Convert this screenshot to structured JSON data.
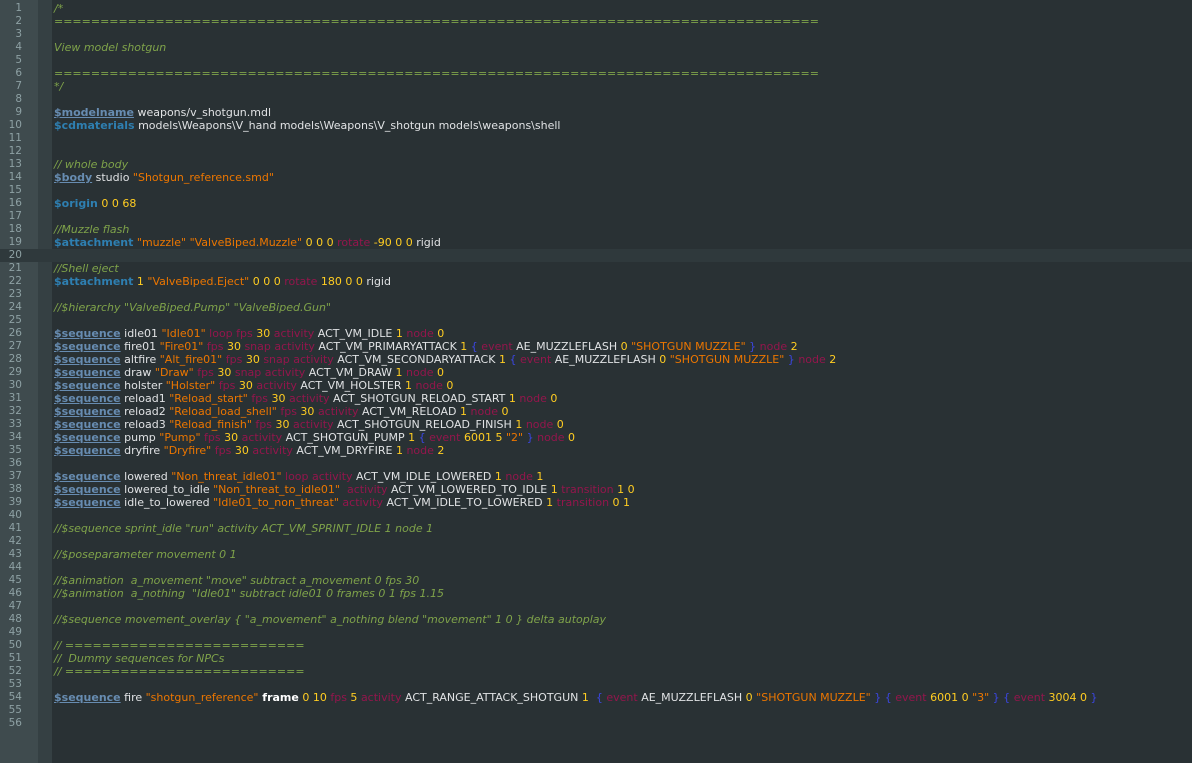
{
  "colors": {
    "background": "#293134",
    "gutter": "#3f4b4e",
    "comment": "#7fa34a",
    "keyword": "#678cb1",
    "string": "#ec7600",
    "number": "#ffcd22",
    "option": "#93164c",
    "brace": "#3b46e0"
  },
  "lines": [
    [
      {
        "t": "/*",
        "c": "cmt"
      }
    ],
    [
      {
        "t": "===================================================================================",
        "c": "cmt"
      }
    ],
    [],
    [
      {
        "t": "View model shotgun",
        "c": "cmt"
      }
    ],
    [],
    [
      {
        "t": "===================================================================================",
        "c": "cmt"
      }
    ],
    [
      {
        "t": "*/",
        "c": "cmt"
      }
    ],
    [],
    [
      {
        "t": "$modelname",
        "c": "kw"
      },
      {
        "t": " weapons/v_shotgun.mdl",
        "c": "plain"
      }
    ],
    [
      {
        "t": "$cdmaterials",
        "c": "kw2"
      },
      {
        "t": " models\\Weapons\\V_hand models\\Weapons\\V_shotgun models\\weapons\\shell",
        "c": "plain"
      }
    ],
    [],
    [],
    [
      {
        "t": "// whole body",
        "c": "cmt"
      }
    ],
    [
      {
        "t": "$body",
        "c": "kw"
      },
      {
        "t": " studio ",
        "c": "plain"
      },
      {
        "t": "\"Shotgun_reference.smd\"",
        "c": "str"
      }
    ],
    [],
    [
      {
        "t": "$origin",
        "c": "kw2"
      },
      {
        "t": " 0 0 68",
        "c": "num"
      }
    ],
    [],
    [
      {
        "t": "//Muzzle flash",
        "c": "cmt"
      }
    ],
    [
      {
        "t": "$attachment",
        "c": "kw2"
      },
      {
        "t": " ",
        "c": "plain"
      },
      {
        "t": "\"muzzle\" \"ValveBiped.Muzzle\"",
        "c": "str"
      },
      {
        "t": " 0 0 0 ",
        "c": "num"
      },
      {
        "t": "rotate",
        "c": "opt"
      },
      {
        "t": " -90 0 0 ",
        "c": "num"
      },
      {
        "t": "rigid",
        "c": "plain"
      }
    ],
    [],
    [
      {
        "t": "//Shell eject",
        "c": "cmt"
      }
    ],
    [
      {
        "t": "$attachment",
        "c": "kw2"
      },
      {
        "t": " 1 ",
        "c": "num"
      },
      {
        "t": "\"ValveBiped.Eject\"",
        "c": "str"
      },
      {
        "t": " 0 0 0 ",
        "c": "num"
      },
      {
        "t": "rotate",
        "c": "opt"
      },
      {
        "t": " 180 0 0 ",
        "c": "num"
      },
      {
        "t": "rigid",
        "c": "plain"
      }
    ],
    [],
    [
      {
        "t": "//$hierarchy \"ValveBiped.Pump\" \"ValveBiped.Gun\"",
        "c": "cmt"
      }
    ],
    [],
    [
      {
        "t": "$sequence",
        "c": "kw"
      },
      {
        "t": " idle01 ",
        "c": "plain"
      },
      {
        "t": "\"Idle01\"",
        "c": "str"
      },
      {
        "t": " loop fps",
        "c": "opt"
      },
      {
        "t": " 30 ",
        "c": "num"
      },
      {
        "t": "activity",
        "c": "opt"
      },
      {
        "t": " ACT_VM_IDLE ",
        "c": "plain"
      },
      {
        "t": "1 ",
        "c": "num"
      },
      {
        "t": "node",
        "c": "opt"
      },
      {
        "t": " 0",
        "c": "num"
      }
    ],
    [
      {
        "t": "$sequence",
        "c": "kw"
      },
      {
        "t": " fire01 ",
        "c": "plain"
      },
      {
        "t": "\"Fire01\"",
        "c": "str"
      },
      {
        "t": " fps",
        "c": "opt"
      },
      {
        "t": " 30 ",
        "c": "num"
      },
      {
        "t": "snap activity",
        "c": "opt"
      },
      {
        "t": " ACT_VM_PRIMARYATTACK ",
        "c": "plain"
      },
      {
        "t": "1 ",
        "c": "num"
      },
      {
        "t": "{ ",
        "c": "brace"
      },
      {
        "t": "event",
        "c": "opt"
      },
      {
        "t": " AE_MUZZLEFLASH ",
        "c": "plain"
      },
      {
        "t": "0 ",
        "c": "num"
      },
      {
        "t": "\"SHOTGUN MUZZLE\"",
        "c": "str"
      },
      {
        "t": " } ",
        "c": "brace"
      },
      {
        "t": "node",
        "c": "opt"
      },
      {
        "t": " 2",
        "c": "num"
      }
    ],
    [
      {
        "t": "$sequence",
        "c": "kw"
      },
      {
        "t": " altfire ",
        "c": "plain"
      },
      {
        "t": "\"Alt_fire01\"",
        "c": "str"
      },
      {
        "t": " fps",
        "c": "opt"
      },
      {
        "t": " 30 ",
        "c": "num"
      },
      {
        "t": "snap activity",
        "c": "opt"
      },
      {
        "t": " ACT_VM_SECONDARYATTACK ",
        "c": "plain"
      },
      {
        "t": "1 ",
        "c": "num"
      },
      {
        "t": "{ ",
        "c": "brace"
      },
      {
        "t": "event",
        "c": "opt"
      },
      {
        "t": " AE_MUZZLEFLASH ",
        "c": "plain"
      },
      {
        "t": "0 ",
        "c": "num"
      },
      {
        "t": "\"SHOTGUN MUZZLE\"",
        "c": "str"
      },
      {
        "t": " } ",
        "c": "brace"
      },
      {
        "t": "node",
        "c": "opt"
      },
      {
        "t": " 2",
        "c": "num"
      }
    ],
    [
      {
        "t": "$sequence",
        "c": "kw"
      },
      {
        "t": " draw ",
        "c": "plain"
      },
      {
        "t": "\"Draw\"",
        "c": "str"
      },
      {
        "t": " fps",
        "c": "opt"
      },
      {
        "t": " 30 ",
        "c": "num"
      },
      {
        "t": "snap activity",
        "c": "opt"
      },
      {
        "t": " ACT_VM_DRAW ",
        "c": "plain"
      },
      {
        "t": "1 ",
        "c": "num"
      },
      {
        "t": "node",
        "c": "opt"
      },
      {
        "t": " 0",
        "c": "num"
      }
    ],
    [
      {
        "t": "$sequence",
        "c": "kw"
      },
      {
        "t": " holster ",
        "c": "plain"
      },
      {
        "t": "\"Holster\"",
        "c": "str"
      },
      {
        "t": " fps",
        "c": "opt"
      },
      {
        "t": " 30 ",
        "c": "num"
      },
      {
        "t": "activity",
        "c": "opt"
      },
      {
        "t": " ACT_VM_HOLSTER ",
        "c": "plain"
      },
      {
        "t": "1 ",
        "c": "num"
      },
      {
        "t": "node",
        "c": "opt"
      },
      {
        "t": " 0",
        "c": "num"
      }
    ],
    [
      {
        "t": "$sequence",
        "c": "kw"
      },
      {
        "t": " reload1 ",
        "c": "plain"
      },
      {
        "t": "\"Reload_start\"",
        "c": "str"
      },
      {
        "t": " fps",
        "c": "opt"
      },
      {
        "t": " 30 ",
        "c": "num"
      },
      {
        "t": "activity",
        "c": "opt"
      },
      {
        "t": " ACT_SHOTGUN_RELOAD_START ",
        "c": "plain"
      },
      {
        "t": "1 ",
        "c": "num"
      },
      {
        "t": "node",
        "c": "opt"
      },
      {
        "t": " 0",
        "c": "num"
      }
    ],
    [
      {
        "t": "$sequence",
        "c": "kw"
      },
      {
        "t": " reload2 ",
        "c": "plain"
      },
      {
        "t": "\"Reload_load_shell\"",
        "c": "str"
      },
      {
        "t": " fps",
        "c": "opt"
      },
      {
        "t": " 30 ",
        "c": "num"
      },
      {
        "t": "activity",
        "c": "opt"
      },
      {
        "t": " ACT_VM_RELOAD ",
        "c": "plain"
      },
      {
        "t": "1 ",
        "c": "num"
      },
      {
        "t": "node",
        "c": "opt"
      },
      {
        "t": " 0",
        "c": "num"
      }
    ],
    [
      {
        "t": "$sequence",
        "c": "kw"
      },
      {
        "t": " reload3 ",
        "c": "plain"
      },
      {
        "t": "\"Reload_finish\"",
        "c": "str"
      },
      {
        "t": " fps",
        "c": "opt"
      },
      {
        "t": " 30 ",
        "c": "num"
      },
      {
        "t": "activity",
        "c": "opt"
      },
      {
        "t": " ACT_SHOTGUN_RELOAD_FINISH ",
        "c": "plain"
      },
      {
        "t": "1 ",
        "c": "num"
      },
      {
        "t": "node",
        "c": "opt"
      },
      {
        "t": " 0",
        "c": "num"
      }
    ],
    [
      {
        "t": "$sequence",
        "c": "kw"
      },
      {
        "t": " pump ",
        "c": "plain"
      },
      {
        "t": "\"Pump\"",
        "c": "str"
      },
      {
        "t": " fps",
        "c": "opt"
      },
      {
        "t": " 30 ",
        "c": "num"
      },
      {
        "t": "activity",
        "c": "opt"
      },
      {
        "t": " ACT_SHOTGUN_PUMP ",
        "c": "plain"
      },
      {
        "t": "1 ",
        "c": "num"
      },
      {
        "t": "{ ",
        "c": "brace"
      },
      {
        "t": "event",
        "c": "opt"
      },
      {
        "t": " 6001 5 ",
        "c": "num"
      },
      {
        "t": "\"2\"",
        "c": "str"
      },
      {
        "t": " } ",
        "c": "brace"
      },
      {
        "t": "node",
        "c": "opt"
      },
      {
        "t": " 0",
        "c": "num"
      }
    ],
    [
      {
        "t": "$sequence",
        "c": "kw"
      },
      {
        "t": " dryfire ",
        "c": "plain"
      },
      {
        "t": "\"Dryfire\"",
        "c": "str"
      },
      {
        "t": " fps",
        "c": "opt"
      },
      {
        "t": " 30 ",
        "c": "num"
      },
      {
        "t": "activity",
        "c": "opt"
      },
      {
        "t": " ACT_VM_DRYFIRE ",
        "c": "plain"
      },
      {
        "t": "1 ",
        "c": "num"
      },
      {
        "t": "node",
        "c": "opt"
      },
      {
        "t": " 2",
        "c": "num"
      }
    ],
    [],
    [
      {
        "t": "$sequence",
        "c": "kw"
      },
      {
        "t": " lowered ",
        "c": "plain"
      },
      {
        "t": "\"Non_threat_idle01\"",
        "c": "str"
      },
      {
        "t": " loop activity",
        "c": "opt"
      },
      {
        "t": " ACT_VM_IDLE_LOWERED ",
        "c": "plain"
      },
      {
        "t": "1 ",
        "c": "num"
      },
      {
        "t": "node",
        "c": "opt"
      },
      {
        "t": " 1",
        "c": "num"
      }
    ],
    [
      {
        "t": "$sequence",
        "c": "kw"
      },
      {
        "t": " lowered_to_idle ",
        "c": "plain"
      },
      {
        "t": "\"Non_threat_to_idle01\"",
        "c": "str"
      },
      {
        "t": "  activity",
        "c": "opt"
      },
      {
        "t": " ACT_VM_LOWERED_TO_IDLE ",
        "c": "plain"
      },
      {
        "t": "1 ",
        "c": "num"
      },
      {
        "t": "transition",
        "c": "opt"
      },
      {
        "t": " 1 0",
        "c": "num"
      }
    ],
    [
      {
        "t": "$sequence",
        "c": "kw"
      },
      {
        "t": " idle_to_lowered ",
        "c": "plain"
      },
      {
        "t": "\"Idle01_to_non_threat\"",
        "c": "str"
      },
      {
        "t": " activity",
        "c": "opt"
      },
      {
        "t": " ACT_VM_IDLE_TO_LOWERED ",
        "c": "plain"
      },
      {
        "t": "1 ",
        "c": "num"
      },
      {
        "t": "transition",
        "c": "opt"
      },
      {
        "t": " 0 1",
        "c": "num"
      }
    ],
    [],
    [
      {
        "t": "//$sequence sprint_idle \"run\" activity ACT_VM_SPRINT_IDLE 1 node 1",
        "c": "cmt"
      }
    ],
    [],
    [
      {
        "t": "//$poseparameter movement 0 1",
        "c": "cmt"
      }
    ],
    [],
    [
      {
        "t": "//$animation  a_movement \"move\" subtract a_movement 0 fps 30",
        "c": "cmt"
      }
    ],
    [
      {
        "t": "//$animation  a_nothing  \"Idle01\" subtract idle01 0 frames 0 1 fps 1.15",
        "c": "cmt"
      }
    ],
    [],
    [
      {
        "t": "//$sequence movement_overlay { \"a_movement\" a_nothing blend \"movement\" 1 0 } delta autoplay",
        "c": "cmt"
      }
    ],
    [],
    [
      {
        "t": "// ==========================",
        "c": "cmt"
      }
    ],
    [
      {
        "t": "//  Dummy sequences for NPCs",
        "c": "cmt"
      }
    ],
    [
      {
        "t": "// ==========================",
        "c": "cmt"
      }
    ],
    [],
    [
      {
        "t": "$sequence",
        "c": "kw"
      },
      {
        "t": " fire ",
        "c": "plain"
      },
      {
        "t": "\"shotgun_reference\"",
        "c": "str"
      },
      {
        "t": " frame",
        "c": "bold"
      },
      {
        "t": " 0 10 ",
        "c": "num"
      },
      {
        "t": "fps",
        "c": "opt"
      },
      {
        "t": " 5 ",
        "c": "num"
      },
      {
        "t": "activity",
        "c": "opt"
      },
      {
        "t": " ACT_RANGE_ATTACK_SHOTGUN ",
        "c": "plain"
      },
      {
        "t": "1  ",
        "c": "num"
      },
      {
        "t": "{ ",
        "c": "brace"
      },
      {
        "t": "event",
        "c": "opt"
      },
      {
        "t": " AE_MUZZLEFLASH ",
        "c": "plain"
      },
      {
        "t": "0 ",
        "c": "num"
      },
      {
        "t": "\"SHOTGUN MUZZLE\"",
        "c": "str"
      },
      {
        "t": " } { ",
        "c": "brace"
      },
      {
        "t": "event",
        "c": "opt"
      },
      {
        "t": " 6001 0 ",
        "c": "num"
      },
      {
        "t": "\"3\"",
        "c": "str"
      },
      {
        "t": " } { ",
        "c": "brace"
      },
      {
        "t": "event",
        "c": "opt"
      },
      {
        "t": " 3004 0 ",
        "c": "num"
      },
      {
        "t": "}",
        "c": "brace"
      }
    ],
    [],
    []
  ],
  "highlighted_line": 20
}
